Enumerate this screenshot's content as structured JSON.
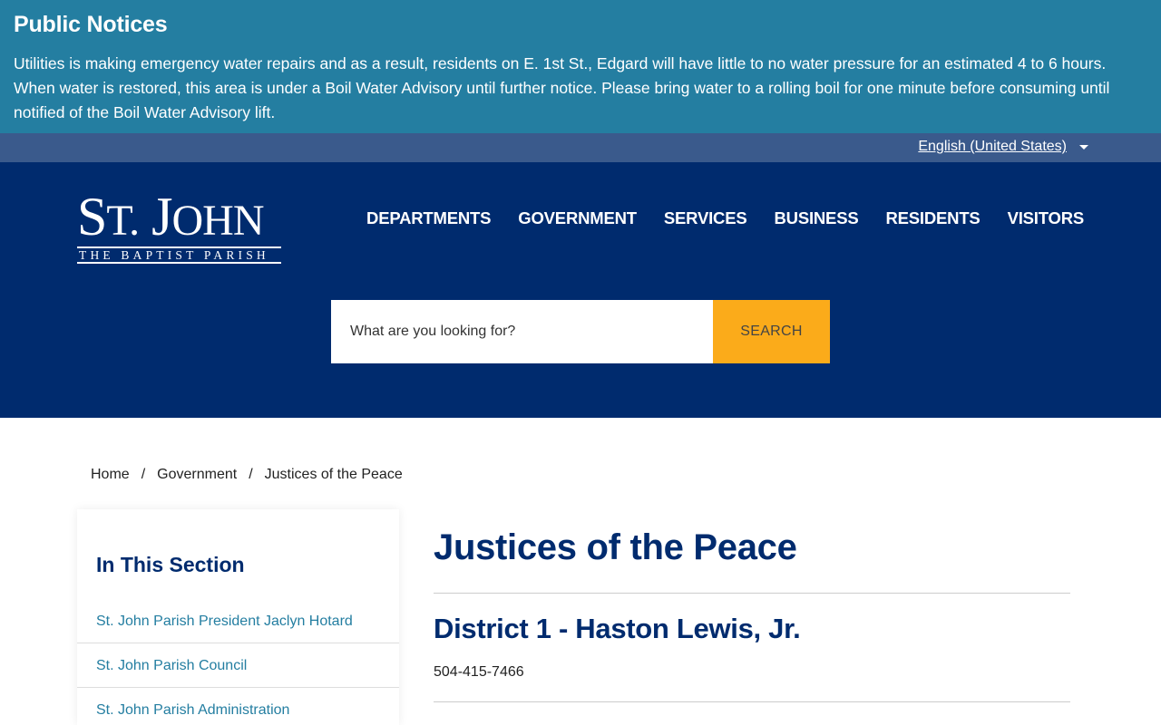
{
  "notice": {
    "title": "Public Notices",
    "text": "Utilities is making emergency water repairs and as a result, residents on E. 1st St., Edgard will have little to no water pressure for an estimated 4 to 6 hours. When water is restored, this area is under a Boil Water Advisory until further notice. Please bring water to a rolling boil for one minute before consuming until notified of the Boil Water Advisory lift."
  },
  "language": {
    "selected": "English (United States)"
  },
  "logo": {
    "main_first": "S",
    "main_small": "T.",
    "main_second": " J",
    "main_small2": "OHN",
    "sub": "THE BAPTIST PARISH"
  },
  "nav": {
    "items": [
      "DEPARTMENTS",
      "GOVERNMENT",
      "SERVICES",
      "BUSINESS",
      "RESIDENTS",
      "VISITORS"
    ]
  },
  "search": {
    "placeholder": "What are you looking for?",
    "button_label": "SEARCH"
  },
  "breadcrumb": {
    "items": [
      "Home",
      "Government",
      "Justices of the Peace"
    ],
    "separator": "/"
  },
  "sidebar": {
    "title": "In This Section",
    "items": [
      "St. John Parish President Jaclyn Hotard",
      "St. John Parish Council",
      "St. John Parish Administration"
    ]
  },
  "main": {
    "title": "Justices of the Peace",
    "district_heading": "District 1 - Haston Lewis, Jr.",
    "phone": "504-415-7466"
  },
  "colors": {
    "notice_bg": "#247ea1",
    "lang_bar": "#3a5a8c",
    "header_bg": "#002b6e",
    "search_button": "#fbab1a",
    "link": "#247ea1"
  },
  "icons": {
    "language_dropdown": "caret-down-icon"
  }
}
